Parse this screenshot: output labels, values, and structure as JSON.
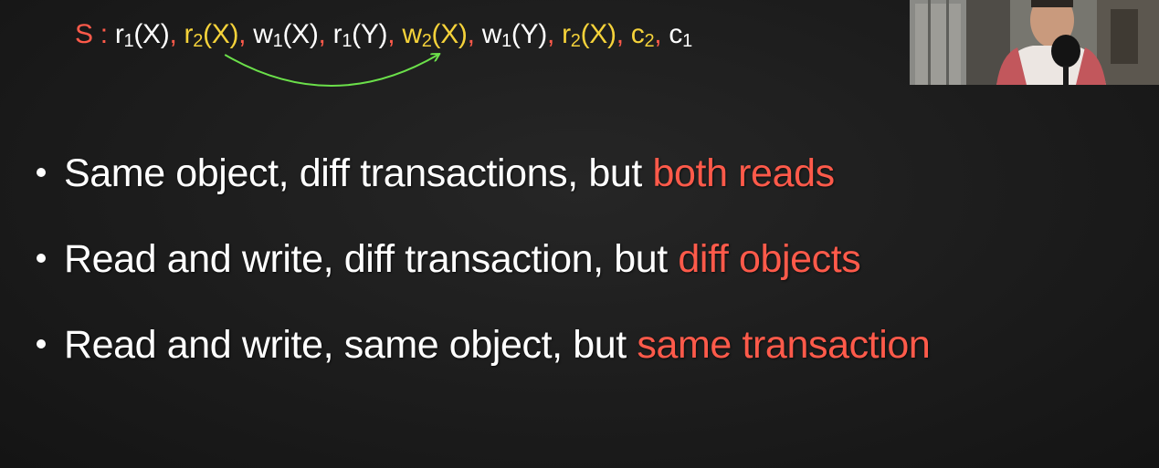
{
  "schedule": {
    "label": "S",
    "separator": " : ",
    "operations": [
      {
        "op": "r",
        "txn": "1",
        "obj": "X",
        "color": "#ffffff",
        "comma": ", "
      },
      {
        "op": "r",
        "txn": "2",
        "obj": "X",
        "color": "#f5d23a",
        "comma": ", "
      },
      {
        "op": "w",
        "txn": "1",
        "obj": "X",
        "color": "#ffffff",
        "comma": ", "
      },
      {
        "op": "r",
        "txn": "1",
        "obj": "Y",
        "color": "#ffffff",
        "comma": ", "
      },
      {
        "op": "w",
        "txn": "2",
        "obj": "X",
        "color": "#f5d23a",
        "comma": ", "
      },
      {
        "op": "w",
        "txn": "1",
        "obj": "Y",
        "color": "#ffffff",
        "comma": ", "
      },
      {
        "op": "r",
        "txn": "2",
        "obj": "X",
        "color": "#f5d23a",
        "comma": ", "
      },
      {
        "op": "c",
        "txn": "2",
        "obj": "",
        "color": "#f5d23a",
        "comma": ", "
      },
      {
        "op": "c",
        "txn": "1",
        "obj": "",
        "color": "#ffffff",
        "comma": ""
      }
    ],
    "arrow": {
      "from_index": 1,
      "to_index": 4,
      "color": "#6be04a"
    }
  },
  "bullets": [
    {
      "text": "Same object, diff transactions, but ",
      "emphasis": "both reads"
    },
    {
      "text": "Read and write, diff transaction, but ",
      "emphasis": "diff objects"
    },
    {
      "text": "Read and write, same object, but ",
      "emphasis": "same transaction"
    }
  ],
  "colors": {
    "label": "#ff5a4a",
    "comma": "#ff5a4a",
    "emphasis": "#ff5a4a",
    "text": "#ffffff",
    "background": "#1c1c1c"
  }
}
